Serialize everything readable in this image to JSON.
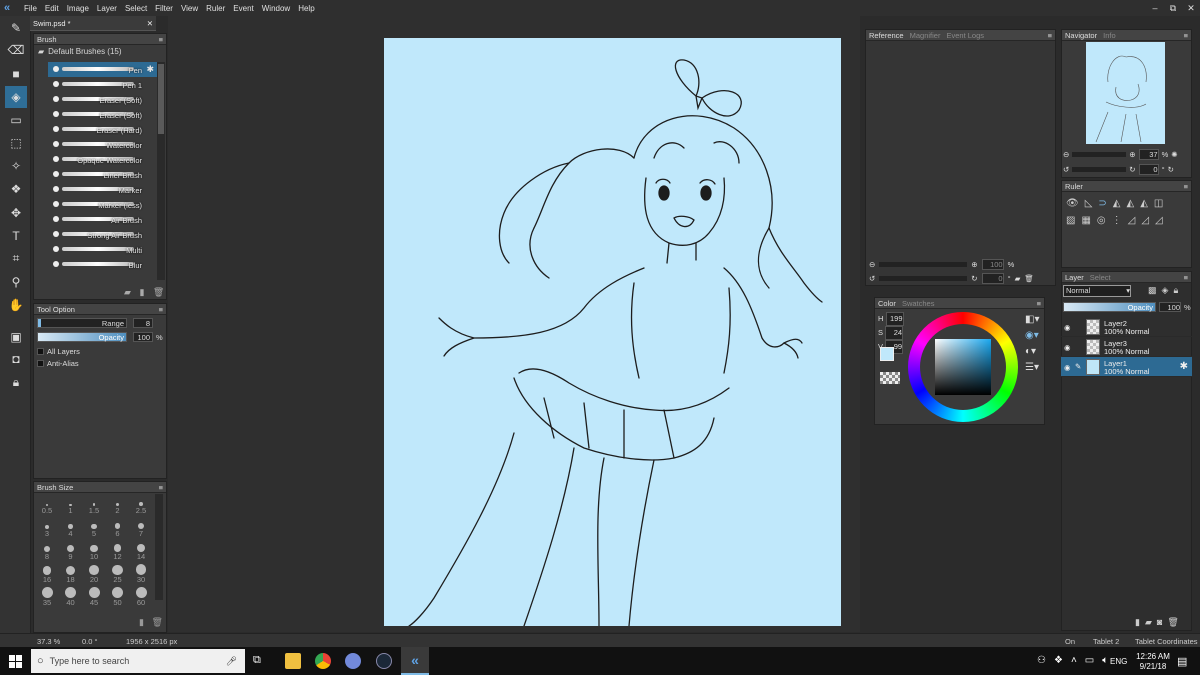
{
  "menu": [
    "File",
    "Edit",
    "Image",
    "Layer",
    "Select",
    "Filter",
    "View",
    "Ruler",
    "Event",
    "Window",
    "Help"
  ],
  "document_tab": {
    "title": "Swim.psd *",
    "close": "✕"
  },
  "window_controls": [
    "–",
    "⧉",
    "✕"
  ],
  "brush_panel": {
    "title": "Brush",
    "group": "Default Brushes (15)",
    "brushes": [
      "Pen",
      "Pen 1",
      "Eraser (Soft)",
      "Eraser (Soft)",
      "Eraser (Hard)",
      "Watercolor",
      "Opaque Watercolor",
      "Liner Brush",
      "Marker",
      "Marker (less)",
      "Air Brush",
      "Strong Air Brush",
      "Multi",
      "Blur"
    ]
  },
  "tool_option": {
    "title": "Tool Option",
    "range_label": "Range",
    "range_value": "8",
    "opacity_label": "Opacity",
    "opacity_value": "100",
    "opacity_unit": "%",
    "opacity_fraction": 1.0,
    "all_layers": "All Layers",
    "anti_alias": "Anti-Alias"
  },
  "brush_size": {
    "title": "Brush Size",
    "sizes": [
      "0.5",
      "1",
      "1.5",
      "2",
      "2.5",
      "3",
      "4",
      "5",
      "6",
      "7",
      "8",
      "9",
      "10",
      "12",
      "14",
      "16",
      "18",
      "20",
      "25",
      "30",
      "35",
      "40",
      "45",
      "50",
      "60"
    ]
  },
  "reference_panel": {
    "tabs": [
      "Reference",
      "Magnifier",
      "Event Logs"
    ],
    "zoom_value": "100",
    "zoom_unit": "%",
    "rotate_value": "0",
    "rotate_unit": "°"
  },
  "color_panel": {
    "tabs": [
      "Color",
      "Swatches"
    ],
    "h_label": "H",
    "h_value": "199",
    "s_label": "S",
    "s_value": "24",
    "v_label": "V",
    "v_value": "99",
    "fg_color": "#c0e8fb",
    "bg_color": "#ffffff"
  },
  "navigator": {
    "tabs": [
      "Navigator",
      "Info"
    ],
    "zoom_value": "37",
    "zoom_unit": "%",
    "rotate_value": "0",
    "rotate_unit": "°"
  },
  "ruler_panel": {
    "title": "Ruler"
  },
  "layer_panel": {
    "tabs": [
      "Layer",
      "Select"
    ],
    "blend_mode": "Normal",
    "opacity_label": "Opacity",
    "opacity_value": "100",
    "opacity_unit": "%",
    "layers": [
      {
        "name": "Layer2",
        "info": "100% Normal"
      },
      {
        "name": "Layer3",
        "info": "100% Normal"
      },
      {
        "name": "Layer1",
        "info": "100% Normal"
      }
    ]
  },
  "status": {
    "zoom": "37.3 %",
    "angle": "0.0 °",
    "size": "1956 x 2516 px",
    "on": "On",
    "tablet": "Tablet 2",
    "coords": "Tablet Coordinates"
  },
  "taskbar": {
    "search_placeholder": "Type here to search",
    "lang": "ENG",
    "time": "12:26 AM",
    "date": "9/21/18"
  },
  "colors": {
    "accent": "#2d6a93",
    "canvas_bg": "#c0e8fb"
  }
}
